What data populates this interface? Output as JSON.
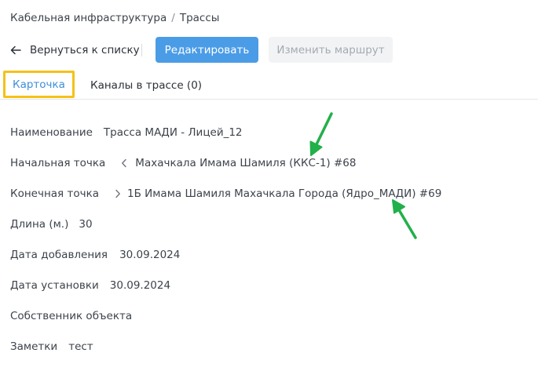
{
  "breadcrumb": {
    "parent": "Кабельная инфраструктура",
    "separator": "/",
    "current": "Трассы"
  },
  "toolbar": {
    "back_label": "Вернуться к списку",
    "edit_label": "Редактировать",
    "change_route_label": "Изменить маршрут"
  },
  "tabs": [
    {
      "label": "Карточка",
      "active": true
    },
    {
      "label": "Каналы в трассе (0)",
      "active": false
    }
  ],
  "fields": {
    "name": {
      "label": "Наименование",
      "value": "Трасса МАДИ - Лицей_12"
    },
    "start": {
      "label": "Начальная точка",
      "value": "Махачкала Имама Шамиля (ККС-1) #68",
      "icon": "chevron-left-icon"
    },
    "end": {
      "label": "Конечная точка",
      "value": "1Б Имама Шамиля Махачкала Города (Ядро_МАДИ) #69",
      "icon": "chevron-right-icon"
    },
    "length": {
      "label": "Длина (м.)",
      "value": "30"
    },
    "added": {
      "label": "Дата добавления",
      "value": "30.09.2024"
    },
    "installed": {
      "label": "Дата установки",
      "value": "30.09.2024"
    },
    "owner": {
      "label": "Собственник объекта",
      "value": ""
    },
    "notes": {
      "label": "Заметки",
      "value": "тест"
    }
  },
  "colors": {
    "primary": "#4b9ce6",
    "tab_active_text": "#3f8fd8",
    "highlight_box": "#f6c118",
    "annotation_arrow": "#22b04a"
  }
}
